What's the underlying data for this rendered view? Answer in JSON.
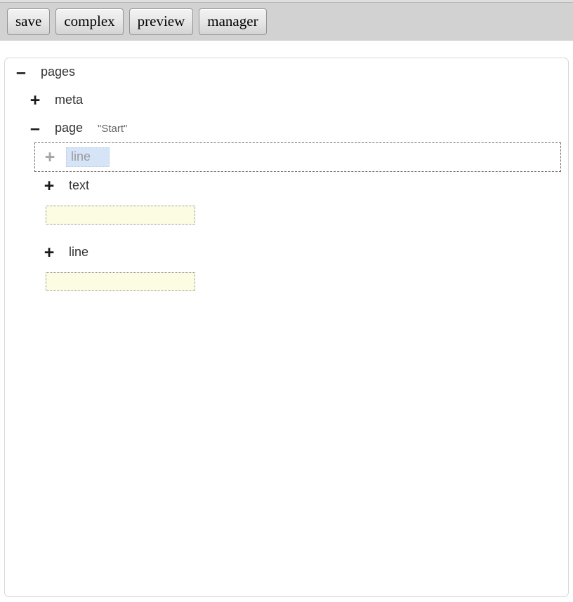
{
  "toolbar": {
    "buttons": [
      {
        "label": "save",
        "name": "save-button"
      },
      {
        "label": "complex",
        "name": "complex-button"
      },
      {
        "label": "preview",
        "name": "preview-button"
      },
      {
        "label": "manager",
        "name": "manager-button"
      }
    ]
  },
  "colors": {
    "toolbar_bg": "#d2d2d2",
    "panel_border": "#d8d8d8",
    "selection_blue": "#d6e4f8",
    "value_field_yellow": "#fcfce2",
    "focus_dash": "#6f6f6f"
  },
  "tree": {
    "nodes": [
      {
        "label": "pages",
        "toggle": "–",
        "toggle_icon": "minus-icon",
        "state": "expanded",
        "depth": 0,
        "attr": "",
        "selected": false
      },
      {
        "label": "meta",
        "toggle": "+",
        "toggle_icon": "plus-icon",
        "state": "collapsed",
        "depth": 1,
        "attr": "",
        "selected": false
      },
      {
        "label": "page",
        "toggle": "–",
        "toggle_icon": "minus-icon",
        "state": "expanded",
        "depth": 1,
        "attr": "\"Start\"",
        "selected": false
      },
      {
        "label": "line",
        "toggle": "+",
        "toggle_icon": "plus-icon",
        "state": "collapsed",
        "depth": 2,
        "attr": "",
        "selected": true
      },
      {
        "label": "text",
        "toggle": "+",
        "toggle_icon": "plus-icon",
        "state": "collapsed",
        "depth": 2,
        "attr": "",
        "selected": false
      }
    ],
    "value_fields": [
      {
        "value": "",
        "placeholder": "",
        "name": "text-value-input"
      },
      {
        "value": "",
        "placeholder": "",
        "name": "line-value-input"
      }
    ],
    "trailing_node": {
      "label": "line",
      "toggle": "+",
      "toggle_icon": "plus-icon",
      "state": "collapsed",
      "depth": 2,
      "attr": "",
      "selected": false
    }
  }
}
